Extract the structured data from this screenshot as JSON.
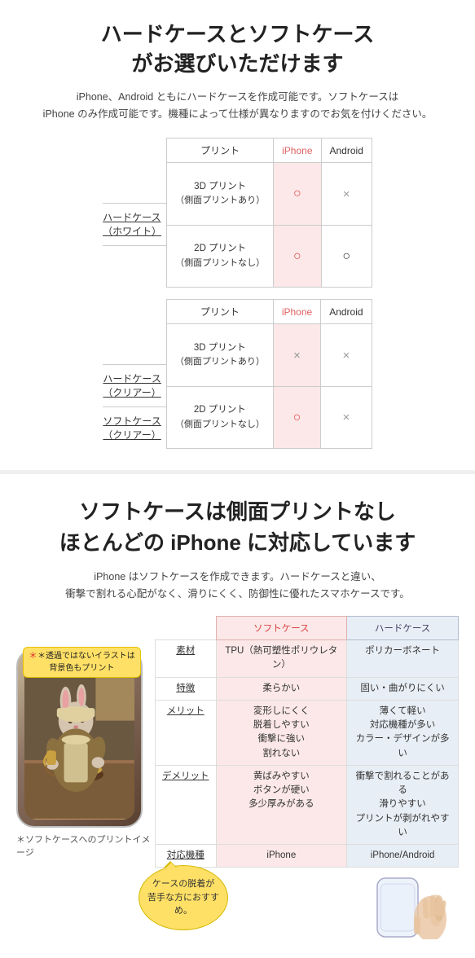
{
  "section1": {
    "title": "ハードケースとソフトケース\nがお選びいただけます",
    "desc": "iPhone、Android ともにハードケースを作成可能です。ソフトケースは\niPhone のみ作成可能です。機種によって仕様が異なりますのでお気を付けください。",
    "table1": {
      "label_line1": "ハードケース",
      "label_line2": "（ホワイト）",
      "col_print": "プリント",
      "col_iphone": "iPhone",
      "col_android": "Android",
      "rows": [
        {
          "print": "3D プリント\n（側面プリントあり）",
          "iphone": "○",
          "android": "×"
        },
        {
          "print": "2D プリント\n（側面プリントなし）",
          "iphone": "○",
          "android": "○"
        }
      ]
    },
    "table2": {
      "label1_line1": "ハードケース",
      "label1_line2": "（クリアー）",
      "label2_line1": "ソフトケース",
      "label2_line2": "（クリアー）",
      "col_print": "プリント",
      "col_iphone": "iPhone",
      "col_android": "Android",
      "rows": [
        {
          "print": "3D プリント\n（側面プリントあり）",
          "iphone": "×",
          "android": "×"
        },
        {
          "print": "2D プリント\n（側面プリントなし）",
          "iphone": "○",
          "android": "×"
        }
      ]
    }
  },
  "section2": {
    "title": "ソフトケースは側面プリントなし\nほとんどの iPhone に対応しています",
    "desc": "iPhone はソフトケースを作成できます。ハードケースと違い、\n衝撃で割れる心配がなく、滑りにくく、防御性に優れたスマホケースです。",
    "note_badge_line1": "＊透過ではないイラストは",
    "note_badge_line2": "背景色もプリント",
    "phone_caption": "＊ソフトケースへのプリントイメージ",
    "callout": "ケースの脱着が\n苦手な方におすすめ。",
    "comp_headers": {
      "soft": "ソフトケース",
      "hard": "ハードケース"
    },
    "comp_rows": [
      {
        "label": "素材",
        "soft": "TPU（熱可塑性ポリウレタン）",
        "hard": "ポリカーボネート"
      },
      {
        "label": "特徴",
        "soft": "柔らかい",
        "hard": "固い・曲がりにくい"
      },
      {
        "label": "メリット",
        "soft": "変形しにくく\n脱着しやすい\n衝撃に強い\n割れない",
        "hard": "薄くて軽い\n対応機種が多い\nカラー・デザインが多い"
      },
      {
        "label": "デメリット",
        "soft": "黄ばみやすい\nボタンが硬い\n多少厚みがある",
        "hard": "衝撃で割れることがある\n滑りやすい\nプリントが剥がれやすい"
      },
      {
        "label": "対応機種",
        "soft": "iPhone",
        "hard": "iPhone/Android"
      }
    ]
  }
}
